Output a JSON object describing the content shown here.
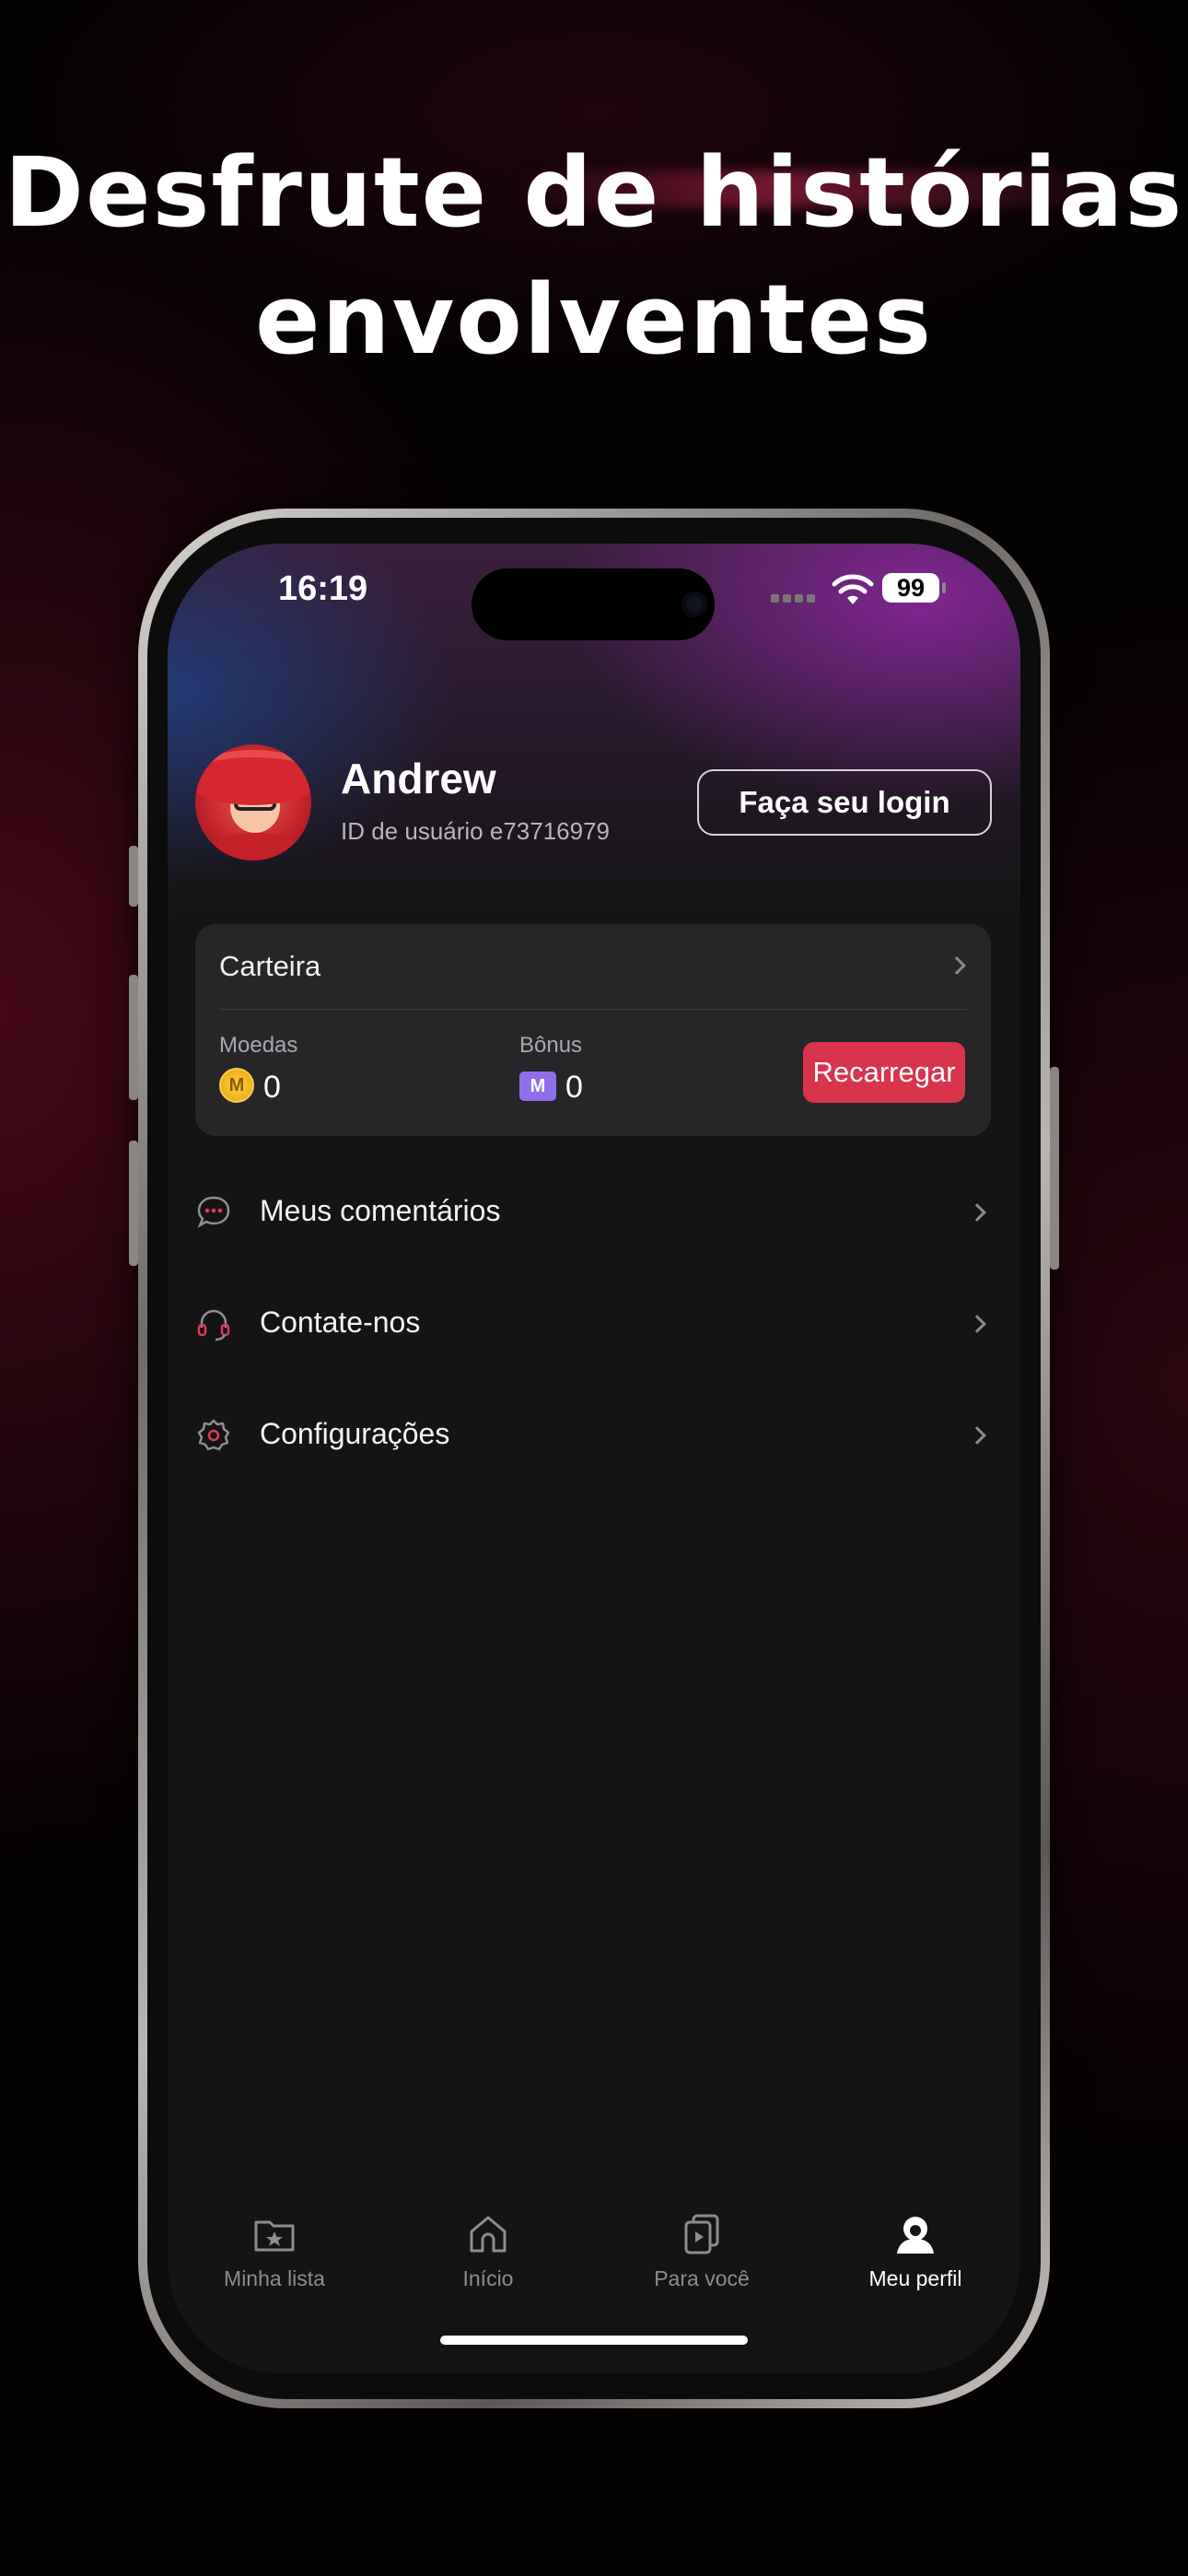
{
  "headline": {
    "line1": "Desfrute de histórias",
    "line2": "envolventes"
  },
  "status_bar": {
    "time": "16:19",
    "battery": "99",
    "icons": [
      "signal-icon",
      "wifi-icon",
      "battery-icon"
    ]
  },
  "profile": {
    "name": "Andrew",
    "user_id": "ID de usuário e73716979",
    "login_button": "Faça seu login"
  },
  "wallet": {
    "title": "Carteira",
    "coins_label": "Moedas",
    "coins_value": "0",
    "bonus_label": "Bônus",
    "bonus_value": "0",
    "recharge_button": "Recarregar",
    "coin_icon_letter": "M"
  },
  "menu": [
    {
      "label": "Meus comentários",
      "icon": "comment-icon"
    },
    {
      "label": "Contate-nos",
      "icon": "headset-icon"
    },
    {
      "label": "Configurações",
      "icon": "settings-gear-icon"
    }
  ],
  "tabs": [
    {
      "label": "Minha lista",
      "icon": "folder-star-icon",
      "active": false
    },
    {
      "label": "Início",
      "icon": "home-icon",
      "active": false
    },
    {
      "label": "Para você",
      "icon": "play-cards-icon",
      "active": false
    },
    {
      "label": "Meu perfil",
      "icon": "profile-icon",
      "active": true
    }
  ],
  "colors": {
    "accent": "#d8344c",
    "background": "#141414",
    "card": "#262629"
  }
}
